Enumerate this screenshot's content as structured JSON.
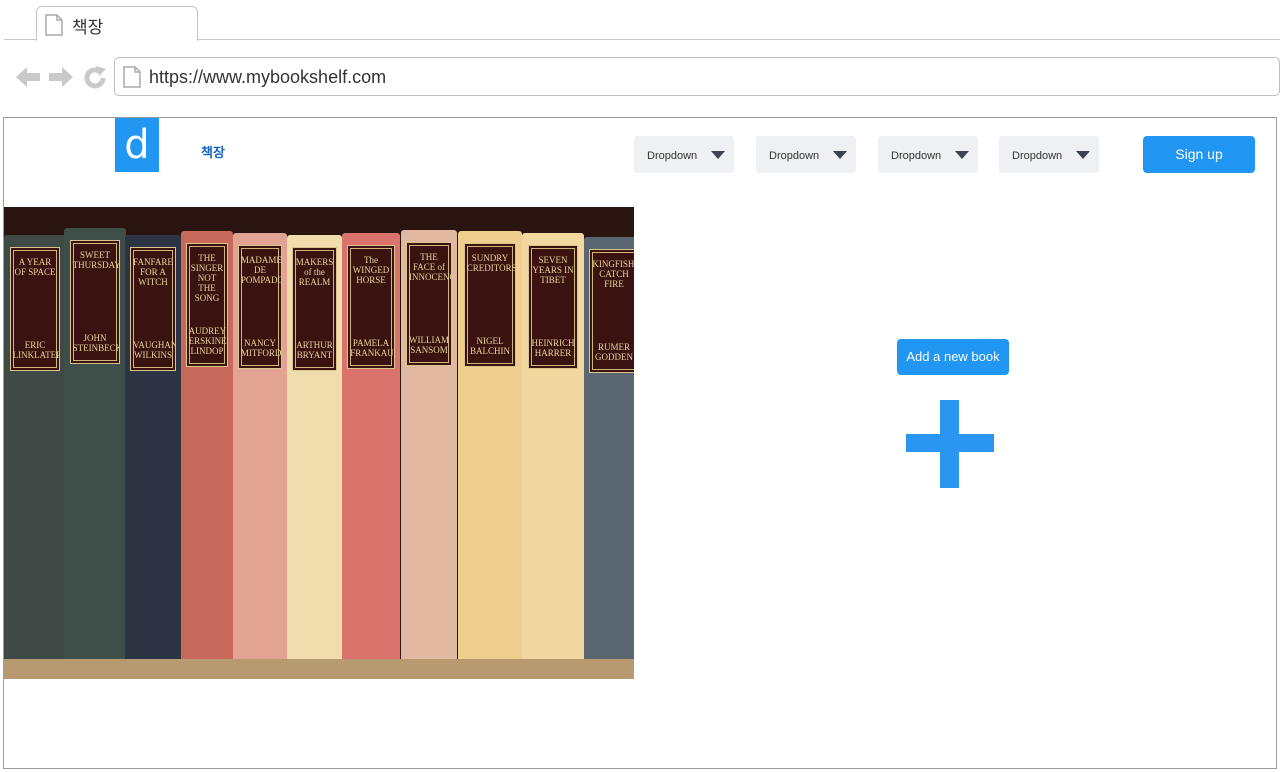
{
  "browser": {
    "tab_title": "책장",
    "url": "https://www.mybookshelf.com"
  },
  "header": {
    "logo_letter": "d",
    "brand": "책장",
    "dropdowns": [
      "Dropdown",
      "Dropdown",
      "Dropdown",
      "Dropdown"
    ],
    "signup_label": "Sign up"
  },
  "main": {
    "add_book_label": "Add a new book"
  },
  "bookshelf": {
    "books": [
      {
        "title": "A YEAR OF SPACE",
        "author": "ERIC LINKLATER",
        "color": "#3f4a46"
      },
      {
        "title": "SWEET THURSDAY",
        "author": "JOHN STEINBECK",
        "color": "#3e4e48"
      },
      {
        "title": "FANFARE FOR A WITCH",
        "author": "VAUGHAN WILKINS",
        "color": "#2c3444"
      },
      {
        "title": "THE SINGER NOT THE SONG",
        "author": "AUDREY ERSKINE LINDOP",
        "color": "#c76a5c"
      },
      {
        "title": "MADAME DE POMPADOUR",
        "author": "NANCY MITFORD",
        "color": "#e3a393"
      },
      {
        "title": "MAKERS of the REALM",
        "author": "ARTHUR BRYANT",
        "color": "#f1dcae"
      },
      {
        "title": "The WINGED HORSE",
        "author": "PAMELA FRANKAU",
        "color": "#d9736b"
      },
      {
        "title": "THE FACE of INNOCENCE",
        "author": "WILLIAM SANSOM",
        "color": "#e0b9a0"
      },
      {
        "title": "SUNDRY CREDITORS",
        "author": "NIGEL BALCHIN",
        "color": "#efcf8f"
      },
      {
        "title": "SEVEN YEARS IN TIBET",
        "author": "HEINRICH HARRER",
        "color": "#f2d8a0"
      },
      {
        "title": "KINGFISHERS CATCH FIRE",
        "author": "RUMER GODDEN",
        "color": "#5a6670"
      }
    ]
  }
}
